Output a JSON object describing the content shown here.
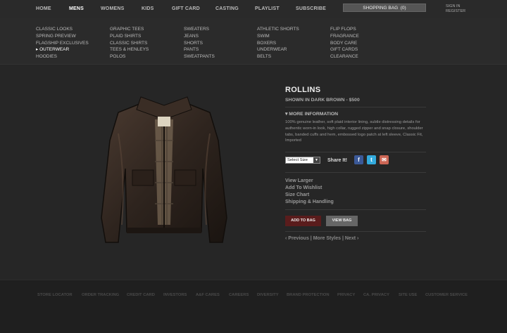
{
  "topnav": {
    "items": [
      "HOME",
      "MENS",
      "WOMENS",
      "KIDS",
      "GIFT CARD",
      "CASTING",
      "PLAYLIST",
      "SUBSCRIBE"
    ],
    "bag_label": "SHOPPING BAG",
    "bag_count": "(0)",
    "sign_in": "SIGN IN",
    "register": "REGISTER"
  },
  "menu": {
    "columns": [
      [
        "CLASSIC LOOKS",
        "SPRING PREVIEW",
        "FLAGSHIP EXCLUSIVES",
        "▸ OUTERWEAR",
        "HOODIES"
      ],
      [
        "GRAPHIC TEES",
        "PLAID SHIRTS",
        "CLASSIC SHIRTS",
        "TEES & HENLEYS",
        "POLOS"
      ],
      [
        "SWEATERS",
        "JEANS",
        "SHORTS",
        "PANTS",
        "SWEATPANTS"
      ],
      [
        "ATHLETIC SHORTS",
        "SWIM",
        "BOXERS",
        "UNDERWEAR",
        "BELTS"
      ],
      [
        "FLIP FLOPS",
        "FRAGRANCE",
        "BODY CARE",
        "GIFT CARDS",
        "CLEARANCE"
      ]
    ]
  },
  "product": {
    "name": "ROLLINS",
    "shown": "SHOWN IN DARK BROWN - $500",
    "more_info": "▾  MORE INFORMATION",
    "description": "100% genuine leather, soft plaid interior lining, subtle distressing details for authentic worn-in look, high collar, rugged zipper and snap closure, shoulder tabs, banded cuffs and hem, embossed logo patch at left sleeve, Classic Fit, Imported",
    "size_placeholder": "Select Size",
    "share_label": "Share It!",
    "links": [
      "View Larger",
      "Add To Wishlist",
      "Size Chart",
      "Shipping & Handling"
    ],
    "add_to_bag": "ADD TO BAG",
    "view_bag": "VIEW BAG",
    "pager": {
      "prev": "‹ Previous",
      "more": "More Styles",
      "next": "Next ›",
      "sep": " | "
    }
  },
  "social": [
    {
      "icon": "facebook-icon",
      "glyph": "f",
      "color": "#3b5998"
    },
    {
      "icon": "twitter-icon",
      "glyph": "t",
      "color": "#33aadd"
    },
    {
      "icon": "email-icon",
      "glyph": "✉",
      "color": "#cc6655"
    }
  ],
  "footer": {
    "links": [
      "STORE LOCATOR",
      "ORDER TRACKING",
      "CREDIT CARD",
      "INVESTORS",
      "A&F CARES",
      "CAREERS",
      "DIVERSITY",
      "BRAND PROTECTION",
      "PRIVACY",
      "CA. PRIVACY",
      "SITE USE",
      "CUSTOMER SERVICE"
    ]
  },
  "colors": {
    "accent": "#5a1c1c",
    "button_gray": "#666666",
    "background": "#262626"
  }
}
